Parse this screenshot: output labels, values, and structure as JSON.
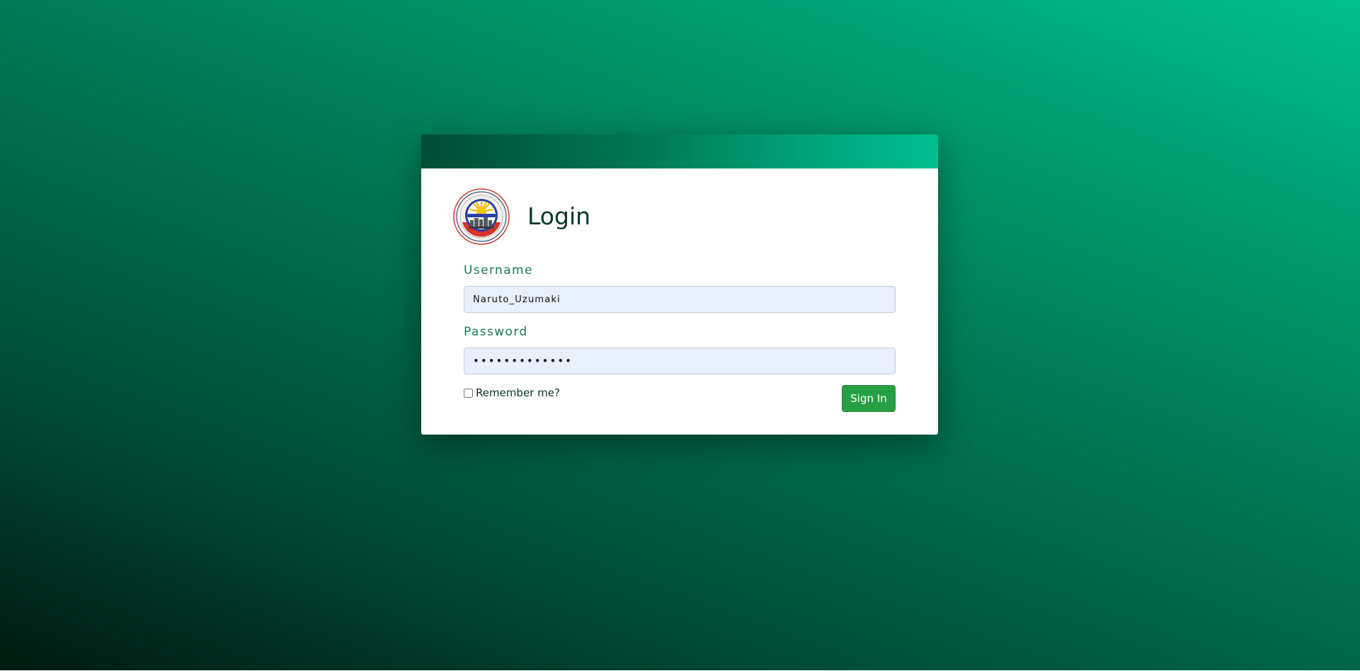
{
  "login": {
    "title": "Login",
    "username_label": "Username",
    "username_value": "Naruto_Uzumaki",
    "password_label": "Password",
    "password_value": "•••••••••••••",
    "remember_label": "Remember me?",
    "remember_checked": false,
    "signin_label": "Sign In"
  },
  "logo": {
    "icon": "municipal-seal-logo"
  },
  "colors": {
    "background_dark": "#001a12",
    "background_light": "#00c08c",
    "heading": "#06382a",
    "label": "#1a7a55",
    "input_bg": "#e8f0fe",
    "button": "#27a043"
  }
}
